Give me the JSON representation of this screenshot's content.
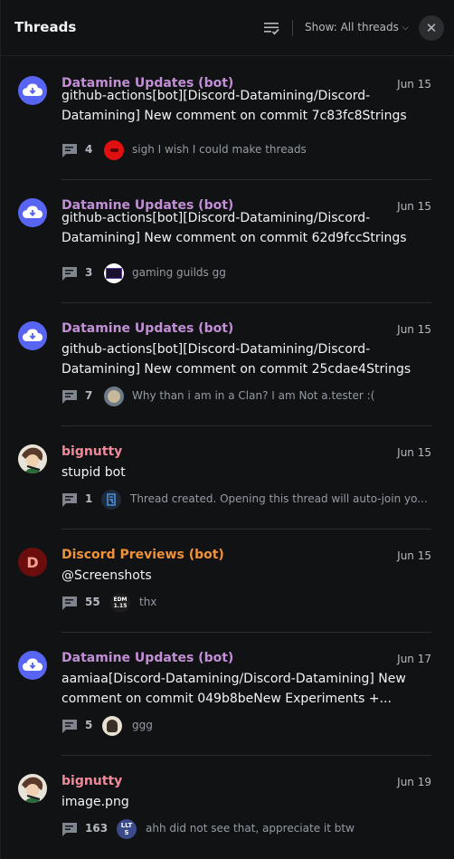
{
  "header": {
    "title": "Threads",
    "show_label": "Show: All threads",
    "close_glyph": "✕"
  },
  "threads": [
    {
      "author": "Datamine Updates (bot)",
      "date": "Jun 15",
      "message": " github-actions[bot][Discord-Datamining/Discord-Datamining] New comment on commit 7c83fc8Strings #...",
      "count": "4",
      "preview": "sigh I wish I could make threads",
      "avatar_icon": "cloud-download-icon"
    },
    {
      "author": "Datamine Updates (bot)",
      "date": "Jun 15",
      "message": " github-actions[bot][Discord-Datamining/Discord-Datamining] New comment on commit 62d9fccStrings #...",
      "count": "3",
      "preview": "gaming guilds gg",
      "avatar_icon": "cloud-download-icon"
    },
    {
      "author": "Datamine Updates (bot)",
      "date": "Jun 15",
      "message": " github-actions[bot][Discord-Datamining/Discord-Datamining] New comment on commit 25cdae4Strings #...",
      "count": "7",
      "preview": "Why than i am in a Clan? I am Not a.tester :(",
      "avatar_icon": "cloud-download-icon"
    },
    {
      "author": "bignutty",
      "date": "Jun 15",
      "message": "stupid bot",
      "count": "1",
      "preview": "Thread created. Opening this thread will auto-join yo..."
    },
    {
      "author": "Discord Previews (bot)",
      "date": "Jun 15",
      "message": "@Screenshots",
      "count": "55",
      "preview": "thx",
      "avatar_letter": "D",
      "mini_text": "EDM 1.15"
    },
    {
      "author": "Datamine Updates (bot)",
      "date": "Jun 17",
      "message": " aamiaa[Discord-Datamining/Discord-Datamining] New comment on commit 049b8beNew Experiments +...",
      "count": "5",
      "preview": "ggg",
      "avatar_icon": "cloud-download-icon"
    },
    {
      "author": "bignutty",
      "date": "Jun 19",
      "message": "image.png",
      "count": "163",
      "preview": "ahh did not see that, appreciate it btw",
      "mini_text": "LLTS"
    }
  ],
  "colors": {
    "background": "#111214",
    "bot_name": "#c28fd6",
    "user_name": "#f08a9b",
    "previews_name": "#f0923a",
    "blurple": "#5865f2"
  }
}
